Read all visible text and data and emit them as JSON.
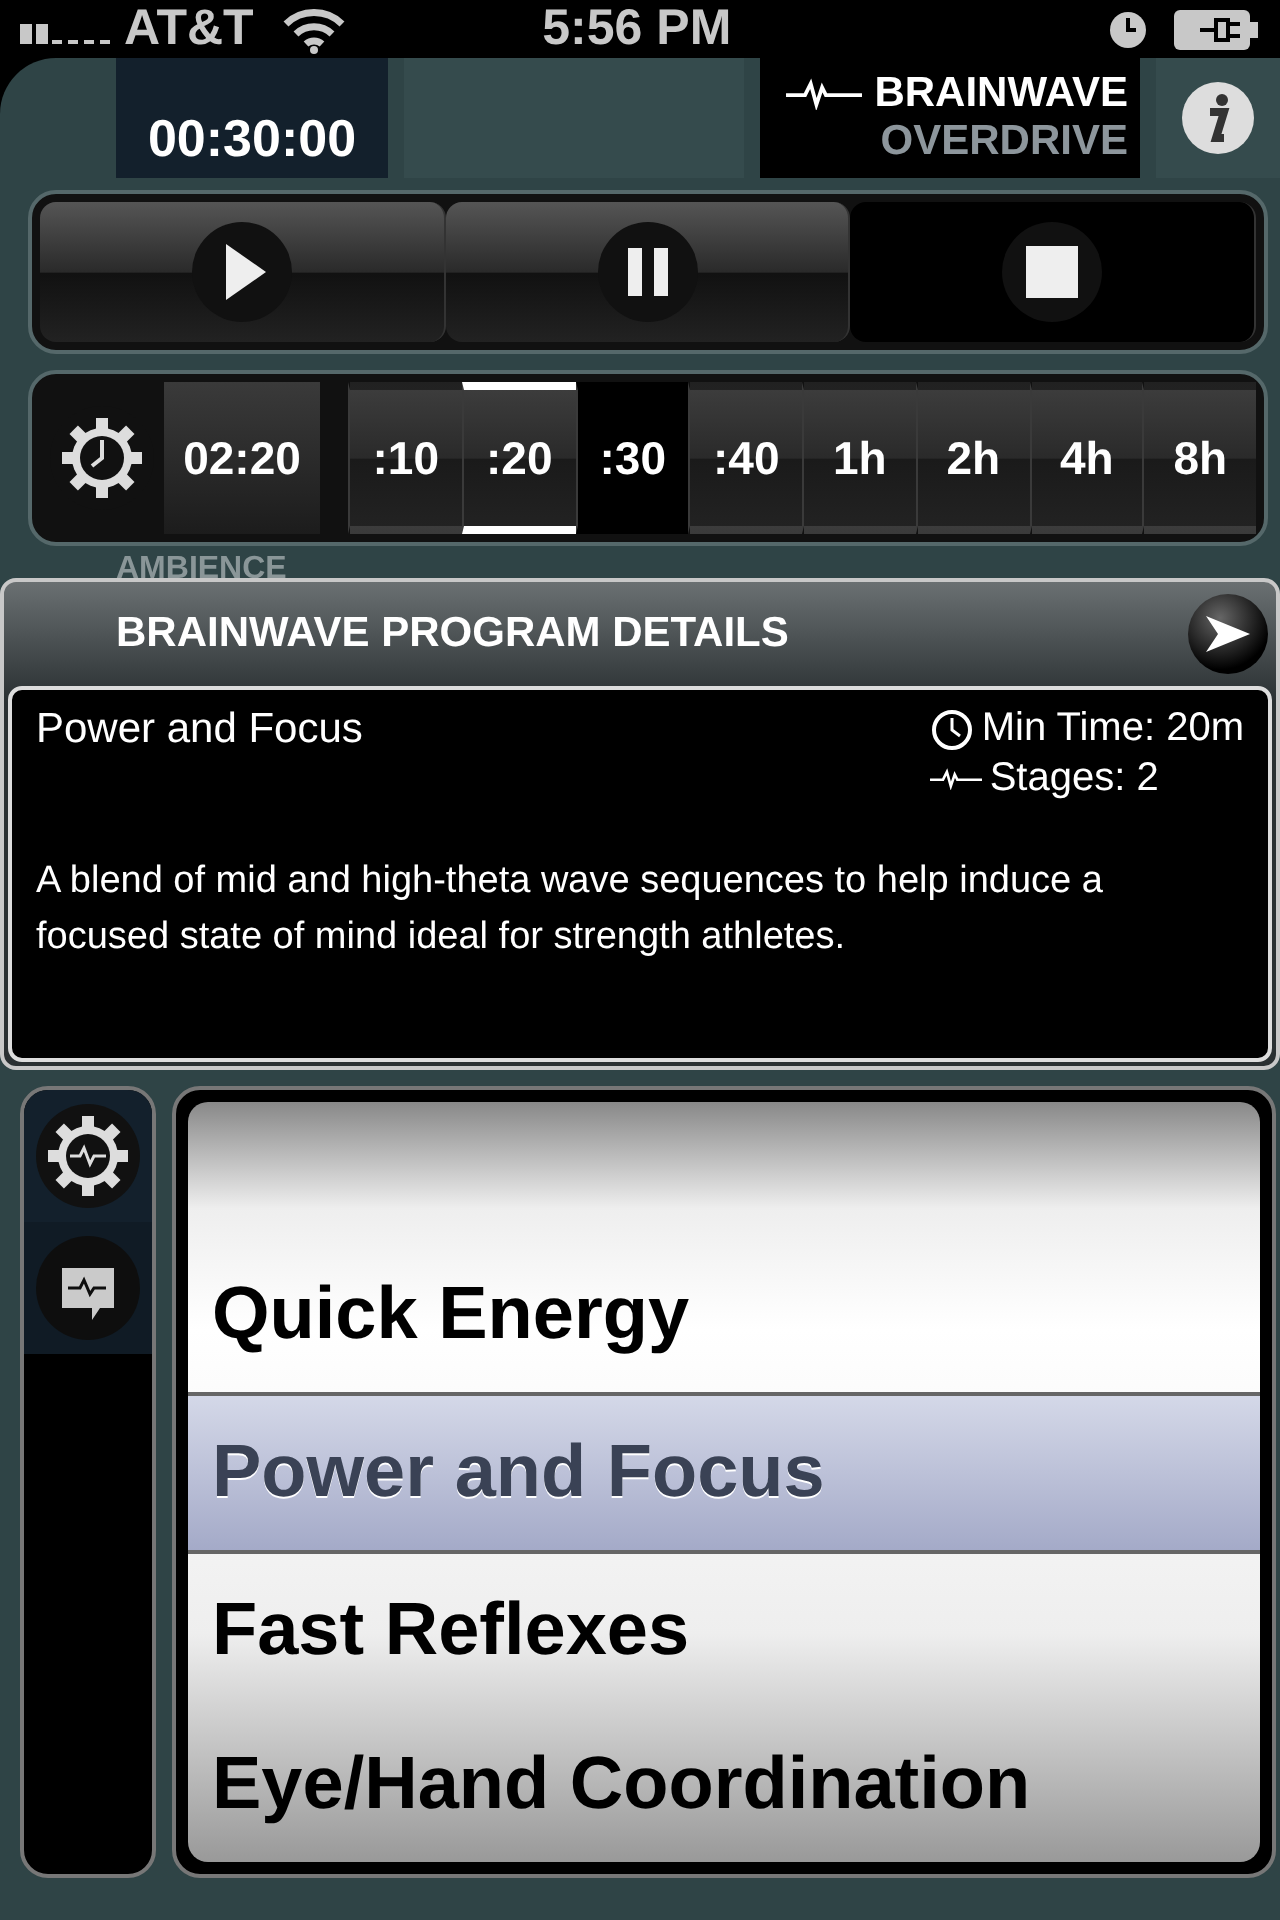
{
  "status_bar": {
    "carrier": "AT&T",
    "time": "5:56 PM"
  },
  "header": {
    "timer": "00:30:00",
    "brand_top": "BRAINWAVE",
    "brand_bottom": "OVERDRIVE"
  },
  "transport": [
    {
      "kind": "play",
      "pressed": false
    },
    {
      "kind": "pause",
      "pressed": false
    },
    {
      "kind": "stop",
      "pressed": true
    }
  ],
  "duration": {
    "current": "02:20",
    "presets": [
      {
        "label": ":10",
        "selected": false,
        "pressed": false
      },
      {
        "label": ":20",
        "selected": true,
        "pressed": false
      },
      {
        "label": ":30",
        "selected": false,
        "pressed": true
      },
      {
        "label": ":40",
        "selected": false,
        "pressed": false
      },
      {
        "label": "1h",
        "selected": false,
        "pressed": false
      },
      {
        "label": "2h",
        "selected": false,
        "pressed": false
      },
      {
        "label": "4h",
        "selected": false,
        "pressed": false
      },
      {
        "label": "8h",
        "selected": false,
        "pressed": false
      }
    ]
  },
  "ambience": {
    "label": "AMBIENCE"
  },
  "details": {
    "title": "BRAINWAVE PROGRAM DETAILS",
    "program": "Power and Focus",
    "min_time": "Min Time: 20m",
    "stages": "Stages: 2",
    "description": "A blend of mid and high-theta wave sequences to help induce a focused state of mind ideal for strength athletes."
  },
  "side_tabs": [
    {
      "kind": "gear",
      "selected": true
    },
    {
      "kind": "bubble",
      "selected": false
    }
  ],
  "programs": [
    {
      "label": "Quick Energy",
      "selected": false
    },
    {
      "label": "Power and Focus",
      "selected": true
    },
    {
      "label": "Fast Reflexes",
      "selected": false
    },
    {
      "label": "Eye/Hand Coordination",
      "selected": false
    }
  ]
}
